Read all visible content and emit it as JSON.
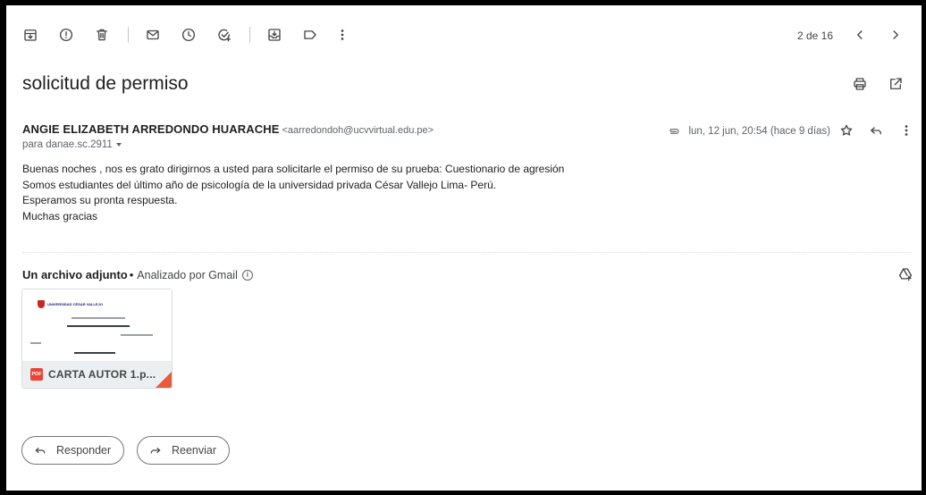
{
  "toolbar": {
    "icons": [
      "archive-icon",
      "report-spam-icon",
      "delete-icon",
      "mark-unread-icon",
      "snooze-icon",
      "add-task-icon",
      "move-to-icon",
      "label-icon",
      "more-vert-icon"
    ],
    "pager": "2 de 16"
  },
  "email": {
    "subject": "solicitud de permiso",
    "sender_name": "ANGIE ELIZABETH ARREDONDO HUARACHE",
    "sender_email": "<aarredondoh@ucvvirtual.edu.pe>",
    "recipient": "para danae.sc.2911",
    "date": "lun, 12 jun, 20:54 (hace 9 días)",
    "body": [
      "Buenas noches , nos es grato dirigirnos a usted para solicitarle el permiso de su prueba: Cuestionario de agresión",
      "Somos estudiantes del último año de psicología de la universidad privada César Vallejo Lima- Perú.",
      "Esperamos su pronta respuesta.",
      "Muchas gracias"
    ]
  },
  "attachments": {
    "title": "Un archivo adjunto",
    "dot": "•",
    "scan_text": "Analizado por Gmail",
    "info_glyph": "i",
    "file": {
      "name": "CARTA AUTOR 1.p...",
      "badge": "PDF",
      "logo_text": "UNIVERSIDAD CÉSAR VALLEJO"
    }
  },
  "actions": {
    "reply": "Responder",
    "forward": "Reenviar"
  },
  "colors": {
    "pdf_red": "#ea4335",
    "corner_orange": "#ea5b3a",
    "text_secondary": "#5f6368"
  }
}
